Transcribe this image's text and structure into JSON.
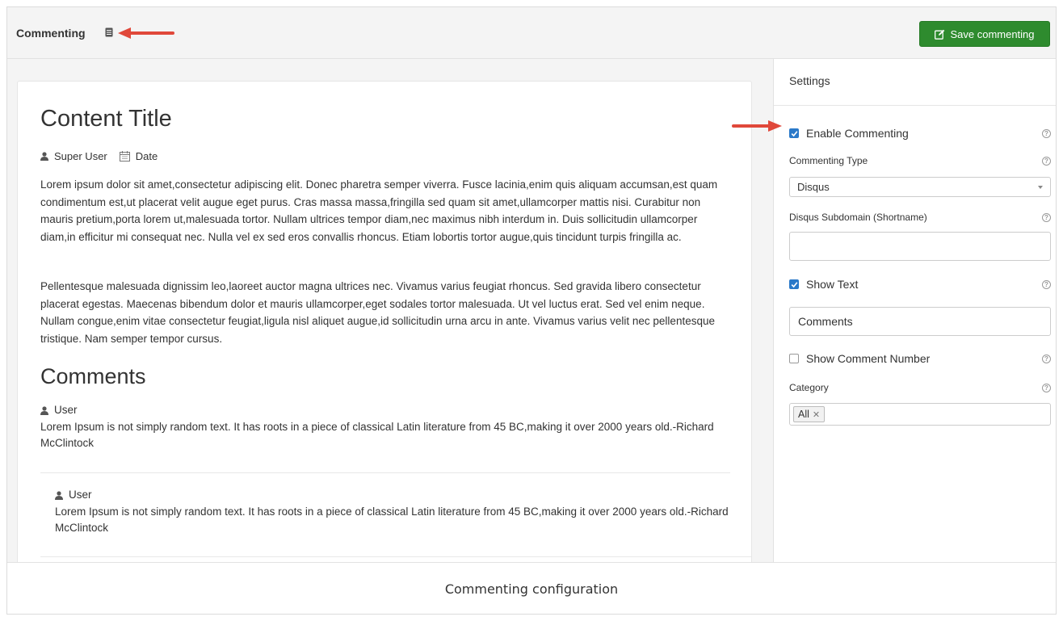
{
  "header": {
    "title": "Commenting",
    "save_label": "Save commenting"
  },
  "article": {
    "title": "Content Title",
    "author": "Super User",
    "date_label": "Date",
    "paragraphs": [
      "Lorem ipsum dolor sit amet,consectetur adipiscing elit. Donec pharetra semper viverra. Fusce lacinia,enim quis aliquam accumsan,est quam condimentum est,ut placerat velit augue eget purus. Cras massa massa,fringilla sed quam sit amet,ullamcorper mattis nisi. Curabitur non mauris pretium,porta lorem ut,malesuada tortor. Nullam ultrices tempor diam,nec maximus nibh interdum in. Duis sollicitudin ullamcorper diam,in efficitur mi consequat nec. Nulla vel ex sed eros convallis rhoncus. Etiam lobortis tortor augue,quis tincidunt turpis fringilla ac.",
      "Pellentesque malesuada dignissim leo,laoreet auctor magna ultrices nec. Vivamus varius feugiat rhoncus. Sed gravida libero consectetur placerat egestas. Maecenas bibendum dolor et mauris ullamcorper,eget sodales tortor malesuada. Ut vel luctus erat. Sed vel enim neque. Nullam congue,enim vitae consectetur feugiat,ligula nisl aliquet augue,id sollicitudin urna arcu in ante. Vivamus varius velit nec pellentesque tristique. Nam semper tempor cursus."
    ],
    "comments_title": "Comments",
    "comments": [
      {
        "user": "User",
        "text": "Lorem Ipsum is not simply random text. It has roots in a piece of classical Latin literature from 45 BC,making it over 2000 years old.-Richard McClintock"
      },
      {
        "user": "User",
        "text": "Lorem Ipsum is not simply random text. It has roots in a piece of classical Latin literature from 45 BC,making it over 2000 years old.-Richard McClintock"
      }
    ]
  },
  "settings": {
    "heading": "Settings",
    "enable_commenting": {
      "label": "Enable Commenting",
      "checked": true
    },
    "commenting_type": {
      "label": "Commenting Type",
      "value": "Disqus"
    },
    "subdomain": {
      "label": "Disqus Subdomain (Shortname)",
      "value": ""
    },
    "show_text": {
      "label": "Show Text",
      "checked": true,
      "value": "Comments"
    },
    "show_comment_number": {
      "label": "Show Comment Number",
      "checked": false
    },
    "category": {
      "label": "Category",
      "tags": [
        "All"
      ]
    },
    "help_glyph": "?"
  },
  "caption": "Commenting configuration",
  "colors": {
    "save_button": "#2e8b2e",
    "checkbox": "#2a79c9",
    "annotation_arrow": "#e0483a"
  },
  "icons": [
    "book-icon",
    "edit-icon",
    "user-icon",
    "calendar-icon",
    "check-icon",
    "help-icon",
    "remove-tag-icon",
    "arrow-annotation"
  ]
}
